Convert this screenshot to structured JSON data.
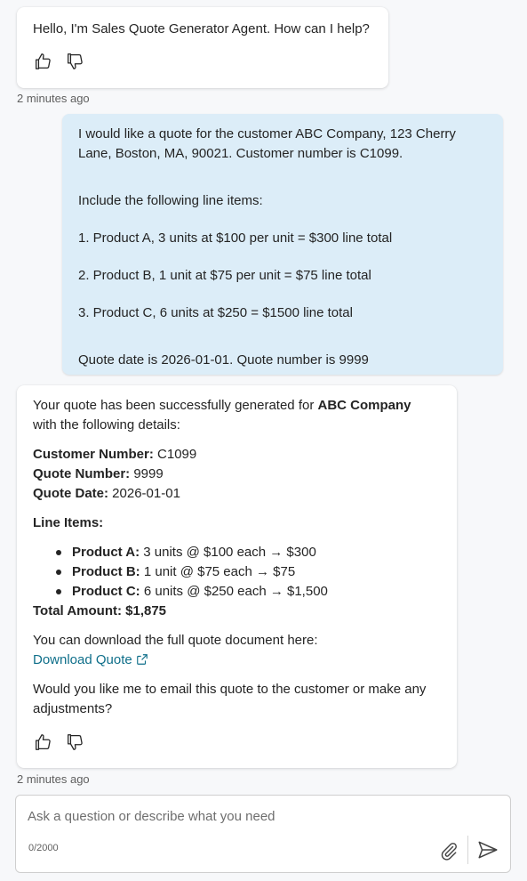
{
  "messages": {
    "greeting": {
      "text": "Hello, I'm Sales Quote Generator Agent. How can I help?",
      "timestamp": "2 minutes ago"
    },
    "user": {
      "lines": [
        "I would like a quote for the customer ABC Company, 123 Cherry Lane, Boston, MA, 90021. Customer number is C1099.",
        "Include the following line items:",
        "1. Product A, 3 units at $100 per unit = $300 line total",
        "2. Product B, 1 unit at $75 per unit = $75 line total",
        "3. Product C, 6 units at $250 = $1500 line total",
        "Quote date is 2026-01-01. Quote number is 9999"
      ]
    },
    "response": {
      "intro_prefix": "Your quote has been successfully generated for ",
      "intro_company": "ABC Company",
      "intro_suffix": "with the following details:",
      "customer_number_label": "Customer Number:",
      "customer_number": " C1099",
      "quote_number_label": "Quote Number:",
      "quote_number": " 9999",
      "quote_date_label": "Quote Date:",
      "quote_date": " 2026-01-01",
      "line_items_label": "Line Items:",
      "items": [
        {
          "name": "Product A:",
          "detail": " 3 units @ $100 each → $300"
        },
        {
          "name": "Product B:",
          "detail": " 1 unit @ $75 each → $75"
        },
        {
          "name": "Product C:",
          "detail": " 6 units @ $250 each → $1,500"
        }
      ],
      "total": "Total Amount: $1,875",
      "download_text": "You can download the full quote document here:",
      "download_link": "Download Quote",
      "followup": "Would you like me to email this quote to the customer or make any adjustments?",
      "timestamp": "2 minutes ago"
    }
  },
  "input": {
    "placeholder": "Ask a question or describe what you need",
    "counter": "0/2000"
  },
  "icons": {
    "thumbs_up": "thumbs-up-icon",
    "thumbs_down": "thumbs-down-icon",
    "external_link": "external-link-icon",
    "attach": "paperclip-icon",
    "send": "send-icon"
  },
  "colors": {
    "user_bubble": "#dcedf8",
    "link": "#0f6f8a"
  }
}
